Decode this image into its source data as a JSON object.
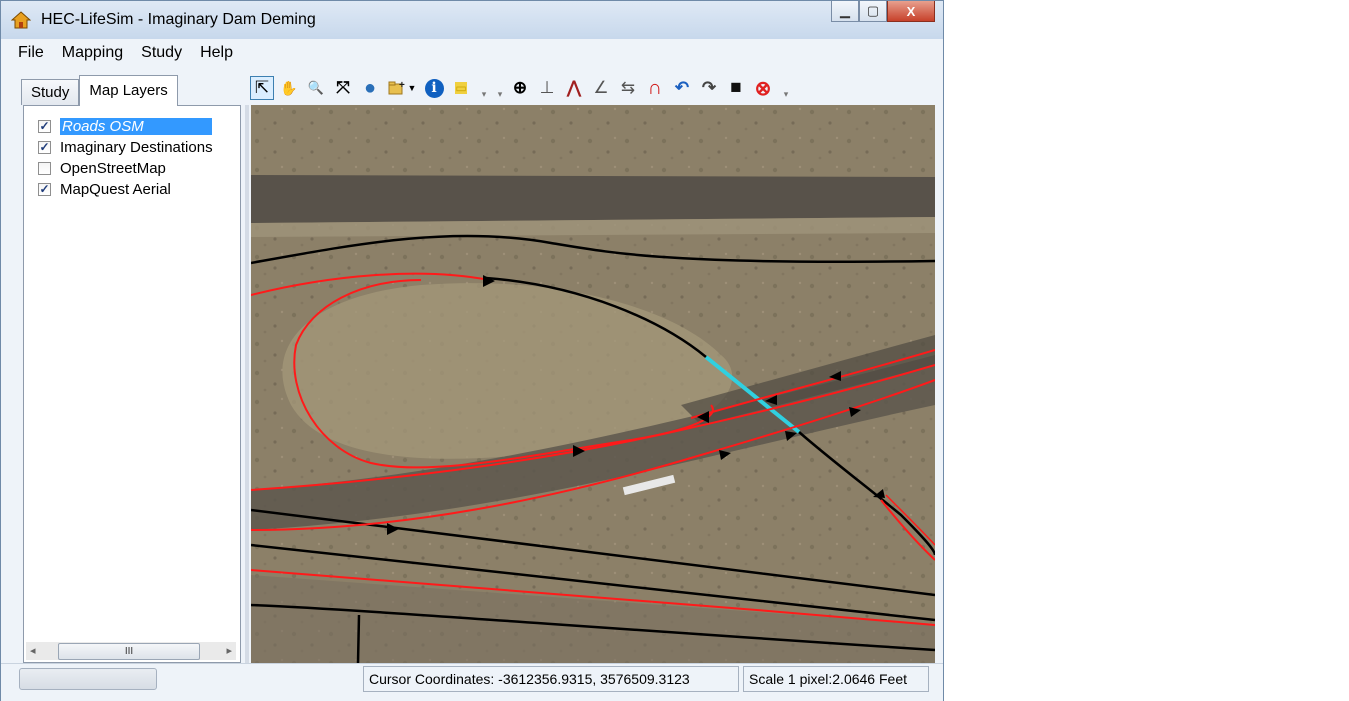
{
  "window": {
    "title": "HEC-LifeSim - Imaginary Dam Deming",
    "app_icon": "house-icon",
    "caption": {
      "minimize": "minimize-icon",
      "maximize": "maximize-icon",
      "close": "close-icon",
      "close_glyph": "X"
    }
  },
  "menu": [
    "File",
    "Mapping",
    "Study",
    "Help"
  ],
  "tabs": [
    {
      "label": "Study",
      "active": false
    },
    {
      "label": "Map Layers",
      "active": true
    }
  ],
  "layers": [
    {
      "label": "Roads OSM",
      "checked": true,
      "selected": true
    },
    {
      "label": "Imaginary Destinations",
      "checked": true,
      "selected": false
    },
    {
      "label": "OpenStreetMap",
      "checked": false,
      "selected": false
    },
    {
      "label": "MapQuest Aerial",
      "checked": true,
      "selected": false
    }
  ],
  "checkmark": "✓",
  "scrollbar": {
    "left": "◂",
    "right": "▸",
    "thumb": "III"
  },
  "toolbar": {
    "select_glyph": "⇱",
    "pan_glyph": "✋",
    "zoom_glyph": "🔍",
    "extent_glyph": "⤧",
    "globe_glyph": "●",
    "add_layer_glyph": "▼",
    "info_glyph": "i",
    "measure_glyph": "▭",
    "crosshair_glyph": "⊕",
    "node_glyph": "⊥",
    "split_glyph": "⋀",
    "edit_glyph": "∠",
    "merge_glyph": "⇆",
    "snap_glyph": "∩",
    "undo_glyph": "↶",
    "redo_glyph": "↷",
    "save_glyph": "■",
    "cancel_glyph": "⊗",
    "grip": "▾"
  },
  "status": {
    "cursor": "Cursor Coordinates: -3612356.9315, 3576509.3123",
    "scale": "Scale 1 pixel:2.0646 Feet"
  },
  "colors": {
    "road_osm": "#ff1a1a",
    "road_black": "#000000",
    "selected_segment": "#30d0e0",
    "terrain": "#8c8068",
    "selection": "#3399ff"
  }
}
